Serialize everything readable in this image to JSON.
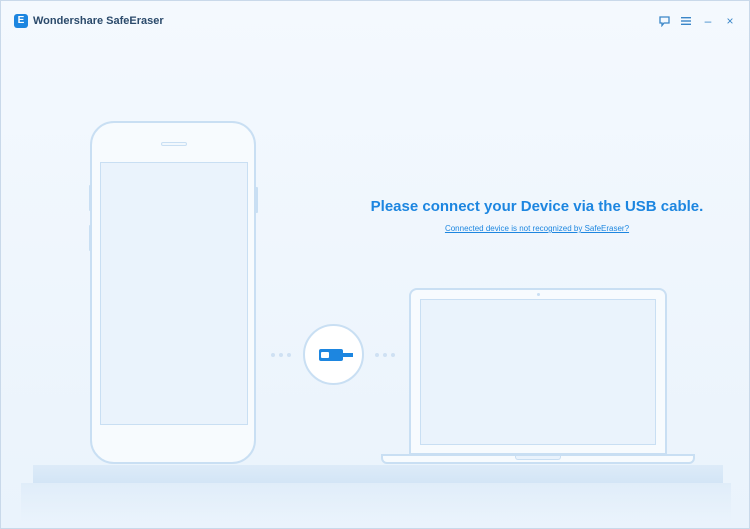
{
  "window": {
    "app_logo_letter": "E",
    "title": "Wondershare SafeEraser",
    "controls": {
      "feedback_icon": "feedback-icon",
      "menu_icon": "menu-icon",
      "minimize_glyph": "–",
      "close_glyph": "×"
    }
  },
  "main": {
    "headline": "Please connect your Device via the USB cable.",
    "help_link": "Connected device is not recognized by SafeEraser?"
  },
  "colors": {
    "accent": "#1d86e0",
    "outline": "#c9dff3",
    "background": "#eaf3fc"
  }
}
